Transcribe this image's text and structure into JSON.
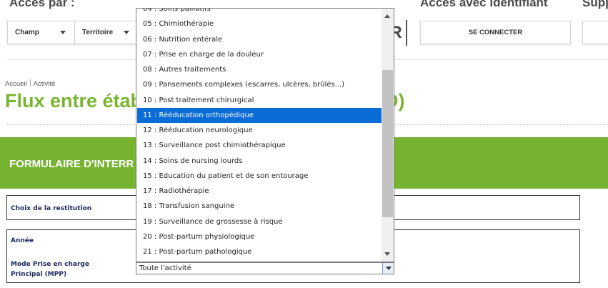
{
  "header": {
    "acces_par": "Accès par :",
    "acces_identifiant": "Accès avec identifiant",
    "support": "Supp",
    "champ_label": "Champ",
    "territoire_label": "Territoire",
    "r_fragment": "R",
    "connect_label": "SE CONNECTER"
  },
  "breadcrumb": {
    "home": "Accueil",
    "current": "Activité"
  },
  "page": {
    "title": "Flux entre étab",
    "title_tail": "D)",
    "form_header": "FORMULAIRE D'INTERR"
  },
  "form": {
    "choix_label": "Choix de la restitution",
    "annee_label": "Année",
    "mpp_label": "Mode Prise en charge Principal (MPP)",
    "mpp_value": "Toute l'activité"
  },
  "dropdown": {
    "items": [
      "04 : Soins palliatifs",
      "05 : Chimiothérapie",
      "06 : Nutrition entérale",
      "07 : Prise en charge de la douleur",
      "08 : Autres traitements",
      "09 : Pansements complexes (escarres, ulcères, brûlés...)",
      "10 : Post traitement chirurgical",
      "11 : Rééducation orthopédique",
      "12 : Rééducation neurologique",
      "13 : Surveillance post chimiothérapique",
      "14 : Soins de nursing lourds",
      "15 : Education du patient et de son entourage",
      "17 : Radiothérapie",
      "18 : Transfusion sanguine",
      "19 : Surveillance de grossesse à risque",
      "20 : Post-partum physiologique",
      "21 : Post-partum pathologique"
    ],
    "selected_index": 7,
    "colors": {
      "selected_bg": "#0a6cd6",
      "brand_green": "#76b330"
    }
  }
}
